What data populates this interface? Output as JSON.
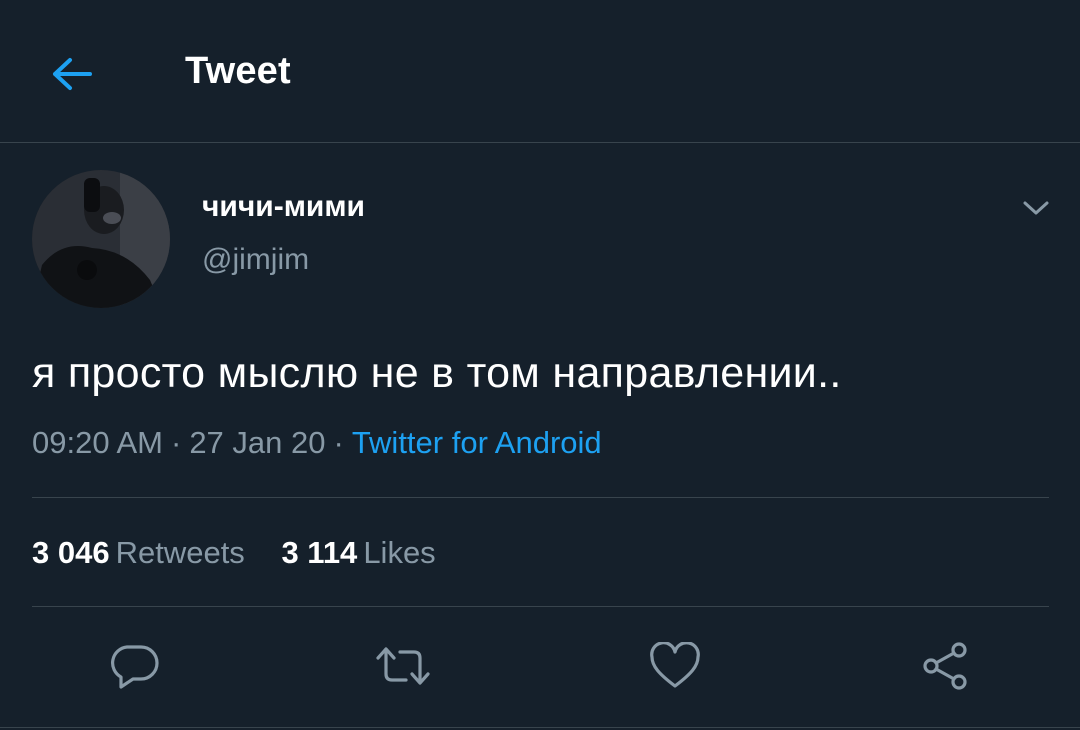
{
  "header": {
    "title": "Tweet",
    "back_icon": "arrow-left-icon"
  },
  "author": {
    "name": "чичи-мими",
    "handle": "@jimjim",
    "avatar": "avatar-photo",
    "menu_icon": "chevron-down-icon"
  },
  "tweet": {
    "text": "я просто мыслю не в том направлении..",
    "time": "09:20 AM",
    "date": "27 Jan 20",
    "separator": "·",
    "source": "Twitter for Android"
  },
  "stats": {
    "retweets_count": "3 046",
    "retweets_label": "Retweets",
    "likes_count": "3 114",
    "likes_label": "Likes"
  },
  "actions": [
    {
      "name": "reply",
      "icon": "reply-bubble-icon"
    },
    {
      "name": "retweet",
      "icon": "retweet-icon"
    },
    {
      "name": "like",
      "icon": "heart-icon"
    },
    {
      "name": "share",
      "icon": "share-icon"
    }
  ],
  "colors": {
    "background": "#15202b",
    "accent": "#1da1f2",
    "secondary_text": "#8899a6",
    "divider": "#38444d"
  }
}
